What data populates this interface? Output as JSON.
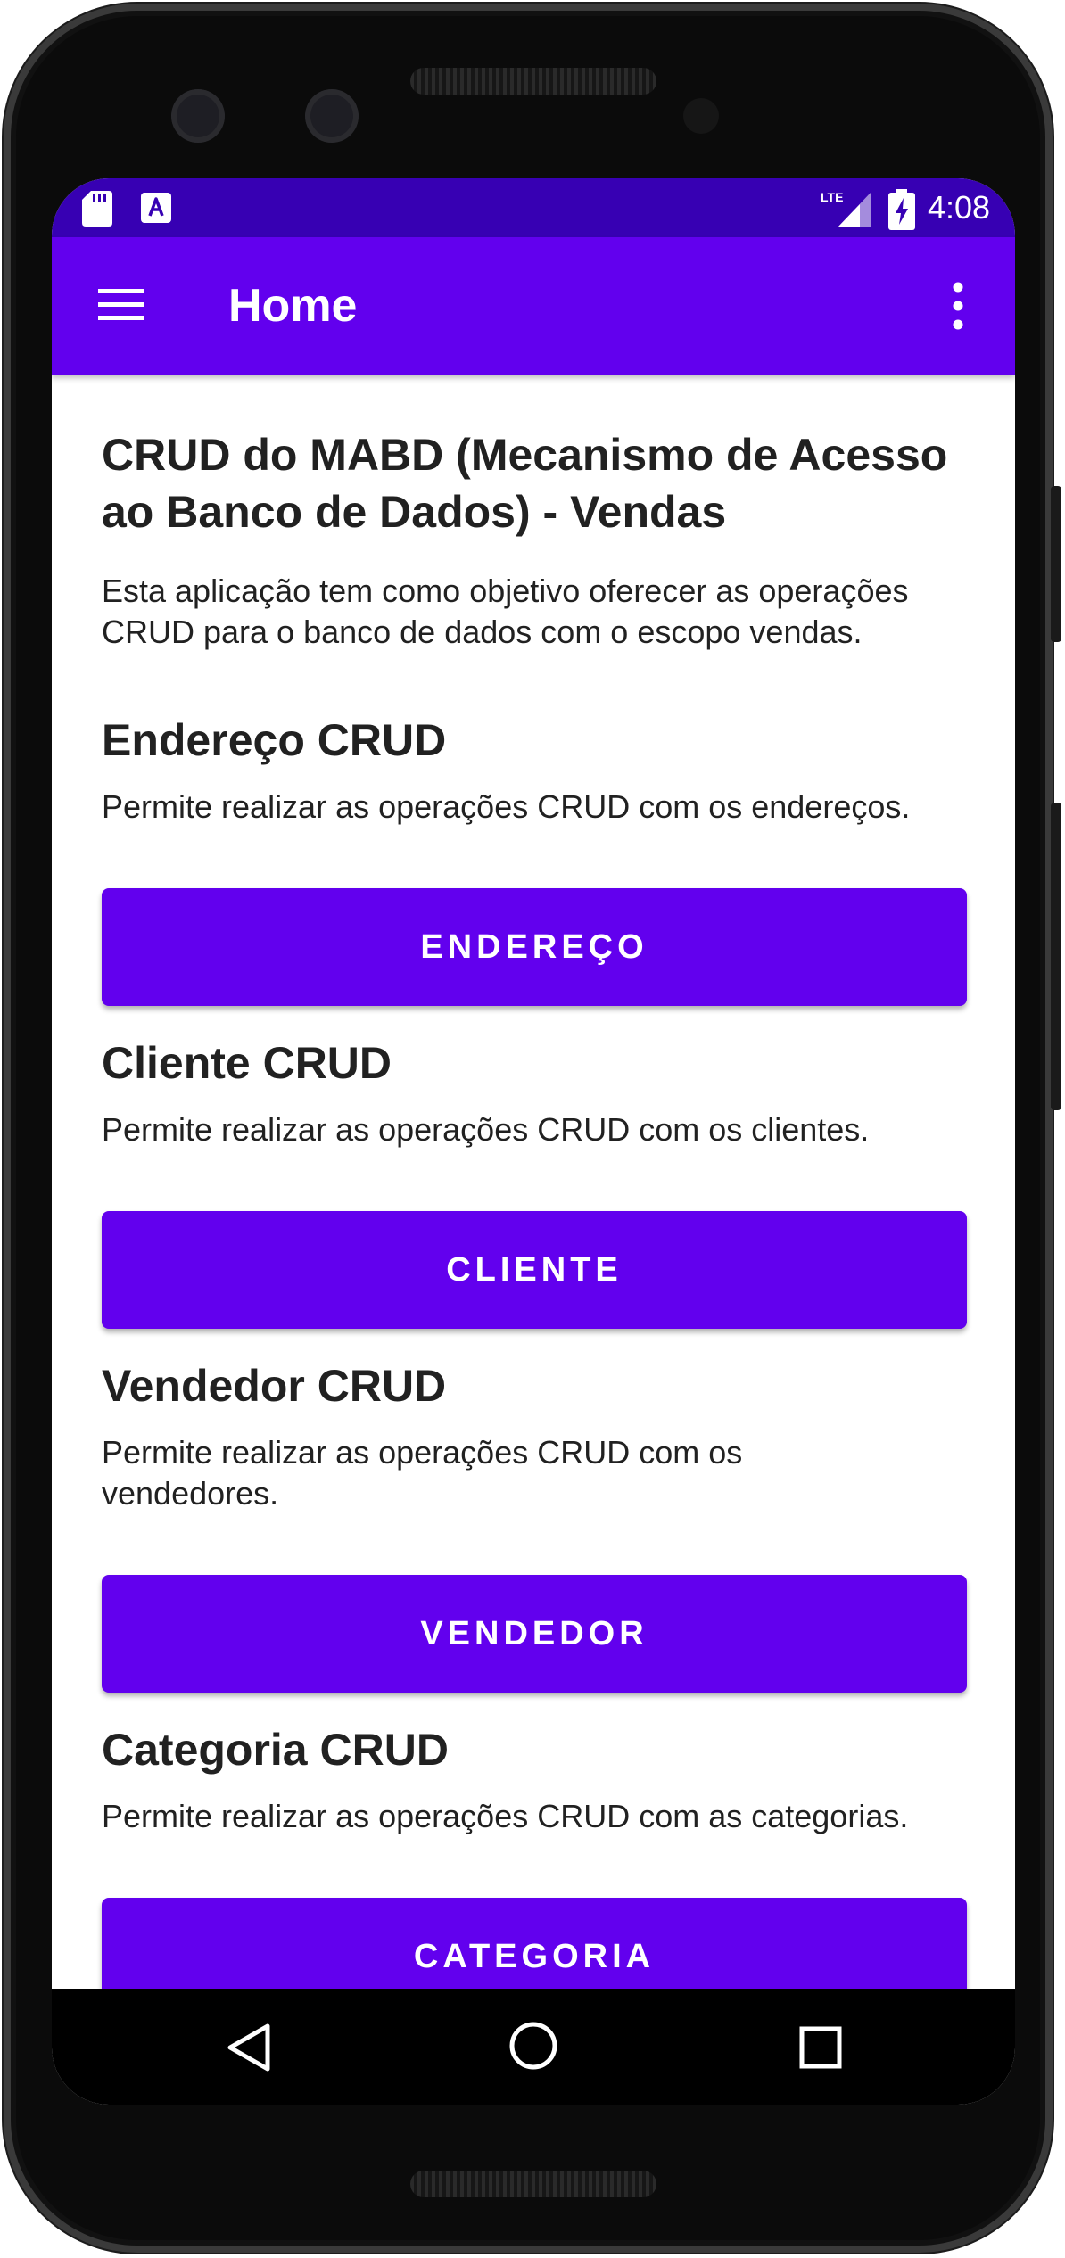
{
  "status_bar": {
    "time": "4:08",
    "network_label": "LTE",
    "icons": [
      "sd-card-icon",
      "a-notification-icon",
      "lte-signal-icon",
      "battery-charging-icon"
    ]
  },
  "app_bar": {
    "title": "Home",
    "menu_icon": "hamburger-menu-icon",
    "overflow_icon": "more-vert-icon",
    "color": "#6200ee",
    "status_color": "#3700b3"
  },
  "main": {
    "heading": "CRUD do MABD (Mecanismo de Acesso ao Banco de Dados) - Vendas",
    "description": "Esta aplicação tem como objetivo oferecer as operações CRUD para o banco de dados com o escopo vendas.",
    "sections": [
      {
        "title": "Endereço CRUD",
        "description": "Permite realizar as operações CRUD com os endereços.",
        "button_label": "ENDEREÇO"
      },
      {
        "title": "Cliente CRUD",
        "description": "Permite realizar as operações CRUD com os clientes.",
        "button_label": "CLIENTE"
      },
      {
        "title": "Vendedor CRUD",
        "description": "Permite realizar as operações CRUD com os vendedores.",
        "button_label": "VENDEDOR"
      },
      {
        "title": "Categoria CRUD",
        "description": "Permite realizar as operações CRUD com as categorias.",
        "button_label": "CATEGORIA"
      }
    ]
  },
  "nav_bar": {
    "icons": [
      "back-icon",
      "home-circle-icon",
      "recents-square-icon"
    ]
  }
}
